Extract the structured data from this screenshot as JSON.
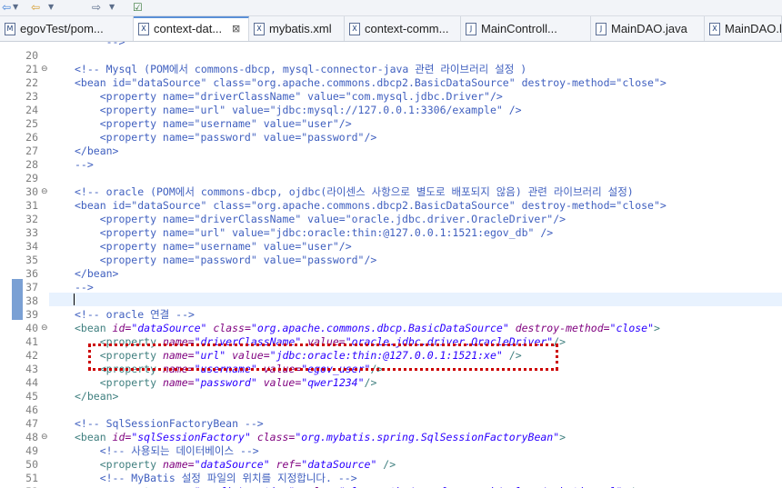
{
  "toolbar": {
    "icons": [
      "arrow-left-icon",
      "dropdown-icon",
      "back-icon",
      "dropdown-icon",
      "forward-icon",
      "dropdown-icon",
      "new-window-icon"
    ]
  },
  "tabs": [
    {
      "label": "egovTest/pom...",
      "icon": "M",
      "active": false,
      "close": ""
    },
    {
      "label": "context-dat...",
      "icon": "X",
      "active": true,
      "close": "⊠"
    },
    {
      "label": "mybatis.xml",
      "icon": "X",
      "active": false,
      "close": ""
    },
    {
      "label": "context-comm...",
      "icon": "X",
      "active": false,
      "close": ""
    },
    {
      "label": "MainControll...",
      "icon": "J",
      "active": false,
      "close": ""
    },
    {
      "label": "MainDAO.java",
      "icon": "J",
      "active": false,
      "close": ""
    },
    {
      "label": "MainDAO.h",
      "icon": "X",
      "active": false,
      "close": ""
    }
  ],
  "editor": {
    "lines": [
      {
        "n": "",
        "fold": "",
        "tokens": [
          {
            "t": "     -->",
            "c": "comment"
          }
        ]
      },
      {
        "n": "20",
        "fold": "",
        "tokens": []
      },
      {
        "n": "21",
        "fold": "⊖",
        "tokens": [
          {
            "t": "<!-- Mysql (POM에서 commons-dbcp, mysql-connector-java 관련 라이브러리 설정 )",
            "c": "comment"
          }
        ]
      },
      {
        "n": "22",
        "fold": "",
        "tokens": [
          {
            "t": "<bean ",
            "c": "comment"
          },
          {
            "t": "id=\"dataSource\" class=\"org.apache.commons.dbcp2.BasicDataSource\" destroy-method=\"close\">",
            "c": "comment"
          }
        ]
      },
      {
        "n": "23",
        "fold": "",
        "tokens": [
          {
            "t": "    <property name=\"driverClassName\" value=\"com.mysql.jdbc.Driver\"/>",
            "c": "comment"
          }
        ]
      },
      {
        "n": "24",
        "fold": "",
        "tokens": [
          {
            "t": "    <property name=\"url\" value=\"jdbc:mysql://127.0.0.1:3306/example\" />",
            "c": "comment"
          }
        ]
      },
      {
        "n": "25",
        "fold": "",
        "tokens": [
          {
            "t": "    <property name=\"username\" value=\"user\"/>",
            "c": "comment"
          }
        ]
      },
      {
        "n": "26",
        "fold": "",
        "tokens": [
          {
            "t": "    <property name=\"password\" value=\"password\"/>",
            "c": "comment"
          }
        ]
      },
      {
        "n": "27",
        "fold": "",
        "tokens": [
          {
            "t": "</bean>",
            "c": "comment"
          }
        ]
      },
      {
        "n": "28",
        "fold": "",
        "tokens": [
          {
            "t": "-->",
            "c": "comment"
          }
        ]
      },
      {
        "n": "29",
        "fold": "",
        "tokens": []
      },
      {
        "n": "30",
        "fold": "⊖",
        "tokens": [
          {
            "t": "<!-- oracle (POM에서 commons-dbcp, ojdbc(라이센스 사항으로 별도로 배포되지 않음) 관련 라이브러리 설정)",
            "c": "comment"
          }
        ]
      },
      {
        "n": "31",
        "fold": "",
        "tokens": [
          {
            "t": "<bean id=\"dataSource\" class=\"org.apache.commons.dbcp2.BasicDataSource\" destroy-method=\"close\">",
            "c": "comment"
          }
        ]
      },
      {
        "n": "32",
        "fold": "",
        "tokens": [
          {
            "t": "    <property name=\"driverClassName\" value=\"oracle.jdbc.driver.OracleDriver\"/>",
            "c": "comment"
          }
        ]
      },
      {
        "n": "33",
        "fold": "",
        "tokens": [
          {
            "t": "    <property name=\"url\" value=\"jdbc:oracle:thin:@127.0.0.1:1521:egov_db\" />",
            "c": "comment"
          }
        ]
      },
      {
        "n": "34",
        "fold": "",
        "tokens": [
          {
            "t": "    <property name=\"username\" value=\"user\"/>",
            "c": "comment"
          }
        ]
      },
      {
        "n": "35",
        "fold": "",
        "tokens": [
          {
            "t": "    <property name=\"password\" value=\"password\"/>",
            "c": "comment"
          }
        ]
      },
      {
        "n": "36",
        "fold": "",
        "tokens": [
          {
            "t": "</bean>",
            "c": "comment"
          }
        ]
      },
      {
        "n": "37",
        "fold": "",
        "tokens": [
          {
            "t": "-->",
            "c": "comment"
          }
        ]
      },
      {
        "n": "38",
        "fold": "",
        "tokens": []
      },
      {
        "n": "39",
        "fold": "",
        "tokens": [
          {
            "t": "<!-- oracle 연결 -->",
            "c": "comment"
          }
        ]
      },
      {
        "n": "40",
        "fold": "⊖",
        "tokens": [
          {
            "t": "<bean ",
            "c": "tag"
          },
          {
            "t": "id=",
            "c": "attr"
          },
          {
            "t": "\"dataSource\"",
            "c": "val"
          },
          {
            "t": " class=",
            "c": "attr"
          },
          {
            "t": "\"org.apache.commons.dbcp.BasicDataSource\"",
            "c": "val"
          },
          {
            "t": " destroy-method=",
            "c": "attr"
          },
          {
            "t": "\"close\"",
            "c": "val"
          },
          {
            "t": ">",
            "c": "tag"
          }
        ]
      },
      {
        "n": "41",
        "fold": "",
        "tokens": [
          {
            "t": "    <property ",
            "c": "tag"
          },
          {
            "t": "name=",
            "c": "attr"
          },
          {
            "t": "\"driverClassName\"",
            "c": "val"
          },
          {
            "t": " value=",
            "c": "attr"
          },
          {
            "t": "\"oracle.jdbc.driver.OracleDriver\"",
            "c": "val"
          },
          {
            "t": "/>",
            "c": "tag"
          }
        ]
      },
      {
        "n": "42",
        "fold": "",
        "tokens": [
          {
            "t": "    <property ",
            "c": "tag"
          },
          {
            "t": "name=",
            "c": "attr"
          },
          {
            "t": "\"url\"",
            "c": "val"
          },
          {
            "t": " value=",
            "c": "attr"
          },
          {
            "t": "\"jdbc:oracle:thin:@127.0.0.1:1521:xe\"",
            "c": "val"
          },
          {
            "t": " />",
            "c": "tag"
          }
        ]
      },
      {
        "n": "43",
        "fold": "",
        "tokens": [
          {
            "t": "    <property ",
            "c": "tag"
          },
          {
            "t": "name=",
            "c": "attr"
          },
          {
            "t": "\"username\"",
            "c": "val"
          },
          {
            "t": " value=",
            "c": "attr"
          },
          {
            "t": "\"egov_user\"",
            "c": "val"
          },
          {
            "t": "/>",
            "c": "tag"
          }
        ]
      },
      {
        "n": "44",
        "fold": "",
        "tokens": [
          {
            "t": "    <property ",
            "c": "tag"
          },
          {
            "t": "name=",
            "c": "attr"
          },
          {
            "t": "\"password\"",
            "c": "val"
          },
          {
            "t": " value=",
            "c": "attr"
          },
          {
            "t": "\"qwer1234\"",
            "c": "val"
          },
          {
            "t": "/>",
            "c": "tag"
          }
        ]
      },
      {
        "n": "45",
        "fold": "",
        "tokens": [
          {
            "t": "</bean>",
            "c": "tag"
          }
        ]
      },
      {
        "n": "46",
        "fold": "",
        "tokens": []
      },
      {
        "n": "47",
        "fold": "",
        "tokens": [
          {
            "t": "<!-- SqlSessionFactoryBean -->",
            "c": "comment"
          }
        ]
      },
      {
        "n": "48",
        "fold": "⊖",
        "tokens": [
          {
            "t": "<bean ",
            "c": "tag"
          },
          {
            "t": "id=",
            "c": "attr"
          },
          {
            "t": "\"sqlSessionFactory\"",
            "c": "val"
          },
          {
            "t": " class=",
            "c": "attr"
          },
          {
            "t": "\"org.mybatis.spring.SqlSessionFactoryBean\"",
            "c": "val"
          },
          {
            "t": ">",
            "c": "tag"
          }
        ]
      },
      {
        "n": "49",
        "fold": "",
        "tokens": [
          {
            "t": "    <!-- 사용되는 데이터베이스 -->",
            "c": "comment"
          }
        ]
      },
      {
        "n": "50",
        "fold": "",
        "tokens": [
          {
            "t": "    <property ",
            "c": "tag"
          },
          {
            "t": "name=",
            "c": "attr"
          },
          {
            "t": "\"dataSource\"",
            "c": "val"
          },
          {
            "t": " ref=",
            "c": "attr"
          },
          {
            "t": "\"dataSource\"",
            "c": "val"
          },
          {
            "t": " />",
            "c": "tag"
          }
        ]
      },
      {
        "n": "51",
        "fold": "",
        "tokens": [
          {
            "t": "    <!-- MyBatis 설정 파일의 위치를 지정합니다. -->",
            "c": "comment"
          }
        ]
      },
      {
        "n": "52",
        "fold": "",
        "tokens": [
          {
            "t": "    <property ",
            "c": "tag"
          },
          {
            "t": "name=",
            "c": "attr"
          },
          {
            "t": "\"configLocation\"",
            "c": "val"
          },
          {
            "t": " value=",
            "c": "attr"
          },
          {
            "t": "\"classpath:/egovframework/sqlmap/mybatis.xml\"",
            "c": "val"
          },
          {
            "t": " />",
            "c": "tag"
          }
        ]
      }
    ]
  },
  "colors": {
    "comment": "#3f5fbf",
    "tag": "#3f7f7f",
    "attr": "#7f007f",
    "val": "#2a00ff",
    "highlight_box": "#cc0000",
    "current_line": "#e8f2fe"
  }
}
